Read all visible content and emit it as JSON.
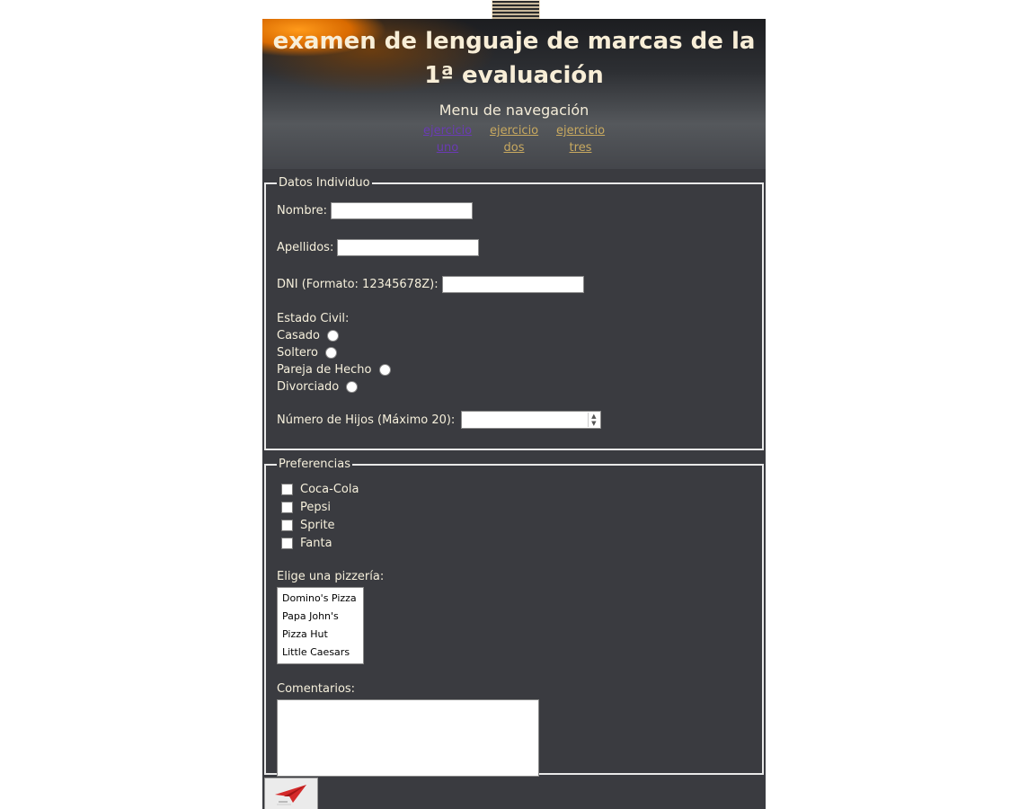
{
  "header": {
    "title": "examen de lenguaje de marcas de la 1ª evaluación",
    "nav_title": "Menu de navegación",
    "nav_links": [
      {
        "label": "ejercicio uno"
      },
      {
        "label": "ejercicio dos"
      },
      {
        "label": "ejercicio tres"
      }
    ]
  },
  "datos": {
    "legend": "Datos Individuo",
    "nombre_label": "Nombre:",
    "nombre_value": "",
    "apellidos_label": "Apellidos:",
    "apellidos_value": "",
    "dni_label": "DNI (Formato: 12345678Z):",
    "dni_value": "",
    "estado_label": "Estado Civil:",
    "estado_options": [
      "Casado",
      "Soltero",
      "Pareja de Hecho",
      "Divorciado"
    ],
    "hijos_label": "Número de Hijos (Máximo 20):",
    "hijos_value": ""
  },
  "preferencias": {
    "legend": "Preferencias",
    "bebidas": [
      "Coca-Cola",
      "Pepsi",
      "Sprite",
      "Fanta"
    ],
    "pizzeria_label": "Elige una pizzería:",
    "pizzerias": [
      "Domino's Pizza",
      "Papa John's",
      "Pizza Hut",
      "Little Caesars"
    ],
    "comentarios_label": "Comentarios:",
    "comentarios_value": ""
  },
  "submit": {
    "icon": "paper-plane-icon"
  },
  "colors": {
    "panel_bg": "#3a3b40",
    "text": "#f6f0dc",
    "link": "#c8a960",
    "link_visited": "#6a3bb3"
  }
}
